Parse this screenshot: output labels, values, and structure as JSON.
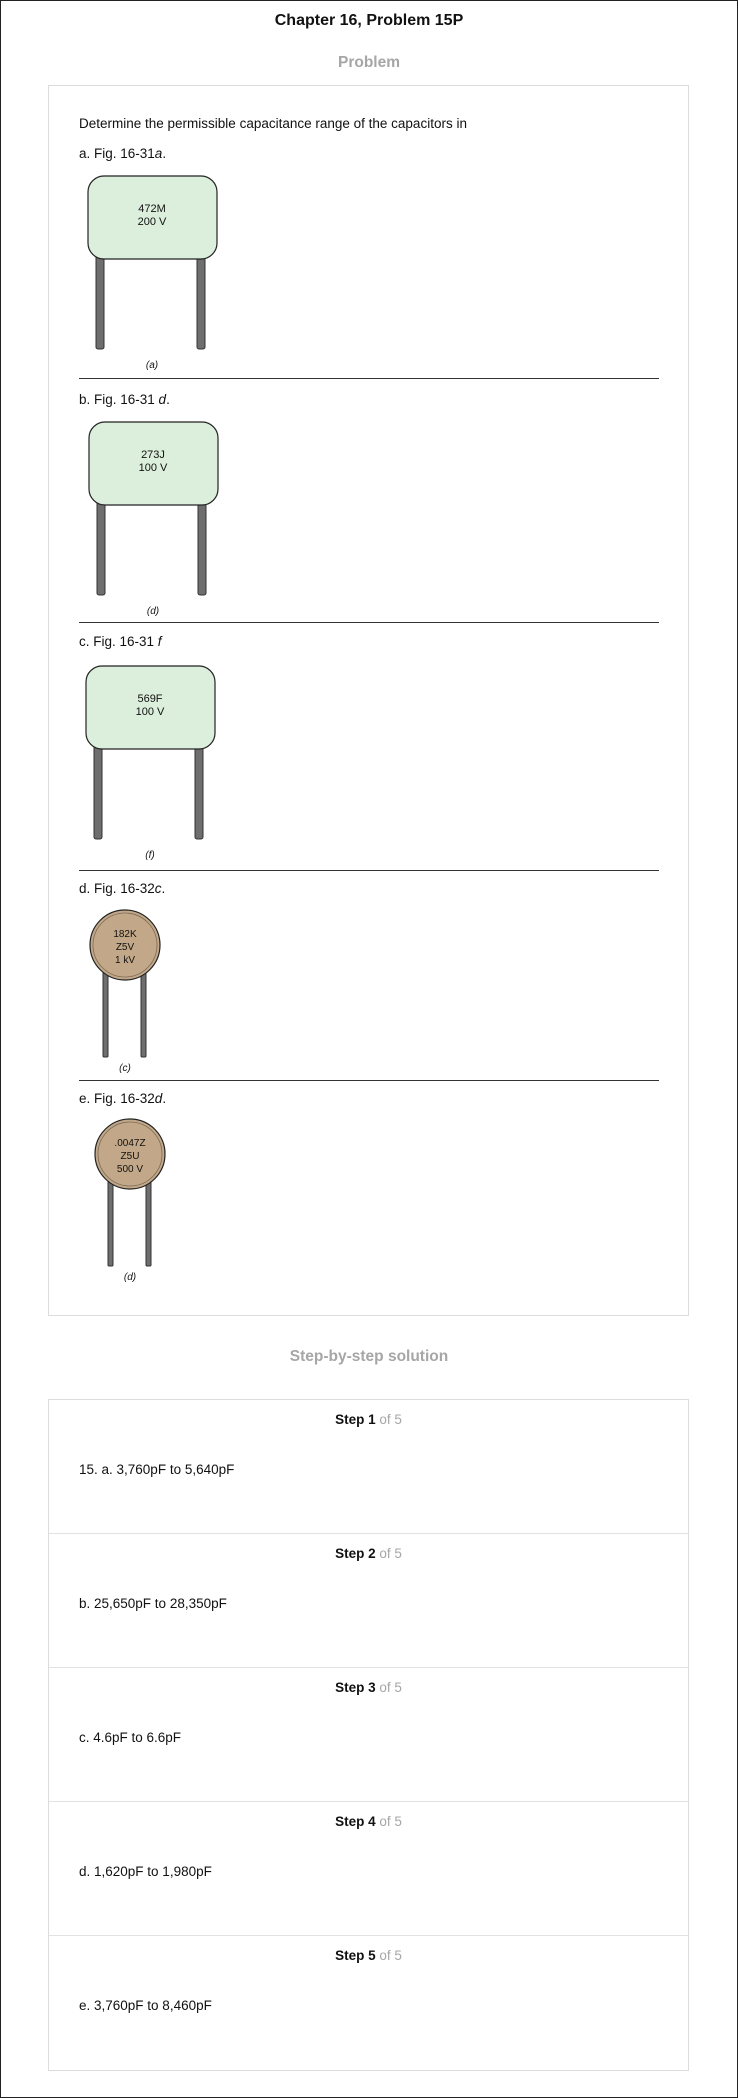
{
  "header": {
    "title": "Chapter 16, Problem 15P"
  },
  "problem": {
    "heading": "Problem",
    "intro": "Determine the permissible capacitance range of the capacitors in",
    "parts": [
      {
        "prefix": "a. Fig. 16-31",
        "suffix": "a",
        "end": ".",
        "code": "472M",
        "voltage": "200 V",
        "caption": "(a)"
      },
      {
        "prefix": "b. Fig. 16-31 ",
        "suffix": "d",
        "end": ".",
        "code": "273J",
        "voltage": "100 V",
        "caption": "(d)"
      },
      {
        "prefix": "c. Fig. 16-31 ",
        "suffix": "f",
        "end": "",
        "code": "569F",
        "voltage": "100 V",
        "caption": "(f)"
      },
      {
        "prefix": "d. Fig. 16-32",
        "suffix": "c",
        "end": ".",
        "code": "182K",
        "dielectric": "Z5V",
        "voltage": "1 kV",
        "caption": "(c)"
      },
      {
        "prefix": "e. Fig. 16-32",
        "suffix": "d",
        "end": ".",
        "code": ".0047Z",
        "dielectric": "Z5U",
        "voltage": "500 V",
        "caption": "(d)"
      }
    ]
  },
  "solution": {
    "heading": "Step-by-step solution",
    "of_label": "of 5",
    "steps": [
      {
        "label": "Step 1",
        "text": "15. a. 3,760pF to 5,640pF"
      },
      {
        "label": "Step 2",
        "text": "b. 25,650pF to 28,350pF"
      },
      {
        "label": "Step 3",
        "text": "c. 4.6pF to 6.6pF"
      },
      {
        "label": "Step 4",
        "text": "d. 1,620pF to 1,980pF"
      },
      {
        "label": "Step 5",
        "text": "e. 3,760pF to 8,460pF"
      }
    ]
  },
  "colors": {
    "film_body": "#dcefdc",
    "ceramic_body": "#c2a888",
    "lead": "#6e6e6e",
    "muted": "#a6a6a6"
  },
  "icons": {
    "film_capacitor": "film-capacitor-illustration",
    "ceramic_capacitor": "ceramic-disc-capacitor-illustration"
  }
}
